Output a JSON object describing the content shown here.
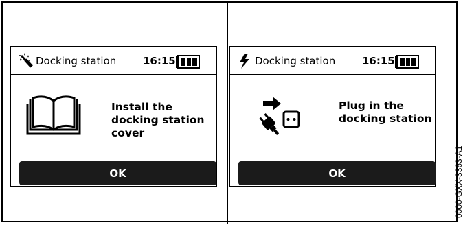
{
  "panels": [
    {
      "icon": "magic-wand-icon",
      "title": "Docking station",
      "time": "16:15",
      "message_lines": [
        "Install the",
        "docking station",
        "cover"
      ],
      "illustration": "open-book-icon",
      "ok_label": "OK"
    },
    {
      "icon": "lightning-bolt-icon",
      "title": "Docking station",
      "time": "16:15",
      "message_lines": [
        "Plug in the",
        "docking station"
      ],
      "illustration": "plug-into-socket-icon",
      "ok_label": "OK"
    }
  ],
  "figure_code": "0000-GXX-3363-A1",
  "colors": {
    "button_bg": "#1b1b1b",
    "button_text": "#ffffff",
    "outline": "#000000"
  }
}
